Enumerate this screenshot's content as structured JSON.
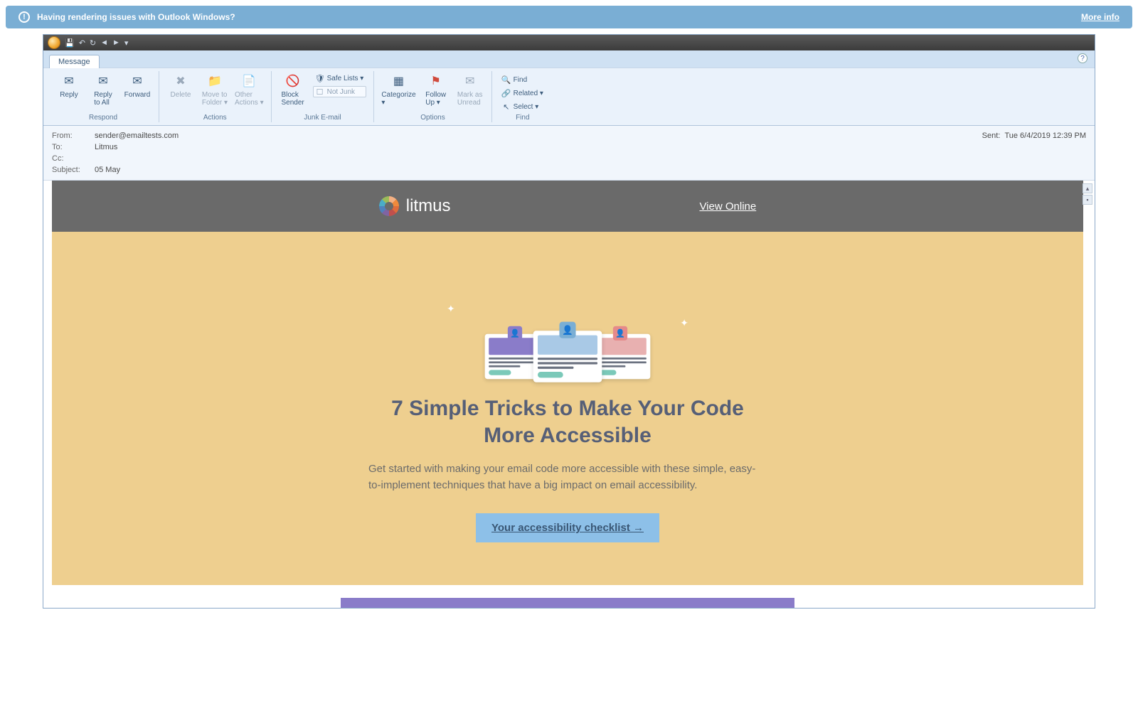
{
  "banner": {
    "message": "Having rendering issues with Outlook Windows?",
    "link": "More info"
  },
  "tabs": {
    "message": "Message"
  },
  "ribbon": {
    "respond": {
      "label": "Respond",
      "reply": "Reply",
      "reply_all": "Reply\nto All",
      "forward": "Forward"
    },
    "actions": {
      "label": "Actions",
      "delete": "Delete",
      "move": "Move to\nFolder ▾",
      "other": "Other\nActions ▾"
    },
    "junk": {
      "label": "Junk E-mail",
      "block": "Block\nSender",
      "safe": "Safe Lists ▾",
      "not_junk": "Not Junk"
    },
    "options": {
      "label": "Options",
      "categorize": "Categorize\n▾",
      "follow": "Follow\nUp ▾",
      "mark": "Mark as\nUnread"
    },
    "find": {
      "label": "Find",
      "find": "Find",
      "related": "Related ▾",
      "select": "Select ▾"
    }
  },
  "headers": {
    "from_k": "From:",
    "from": "sender@emailtests.com",
    "to_k": "To:",
    "to": "Litmus",
    "cc_k": "Cc:",
    "subject_k": "Subject:",
    "subject": "05 May",
    "sent_k": "Sent:",
    "sent": "Tue 6/4/2019 12:39 PM"
  },
  "email": {
    "brand": "litmus",
    "view_online": "View Online",
    "title": "7 Simple Tricks to Make Your Code More Accessible",
    "subtitle": "Get started with making your email code more accessible with these simple, easy-to-implement techniques that have a big impact on email accessibility.",
    "cta": "Your accessibility checklist →"
  }
}
